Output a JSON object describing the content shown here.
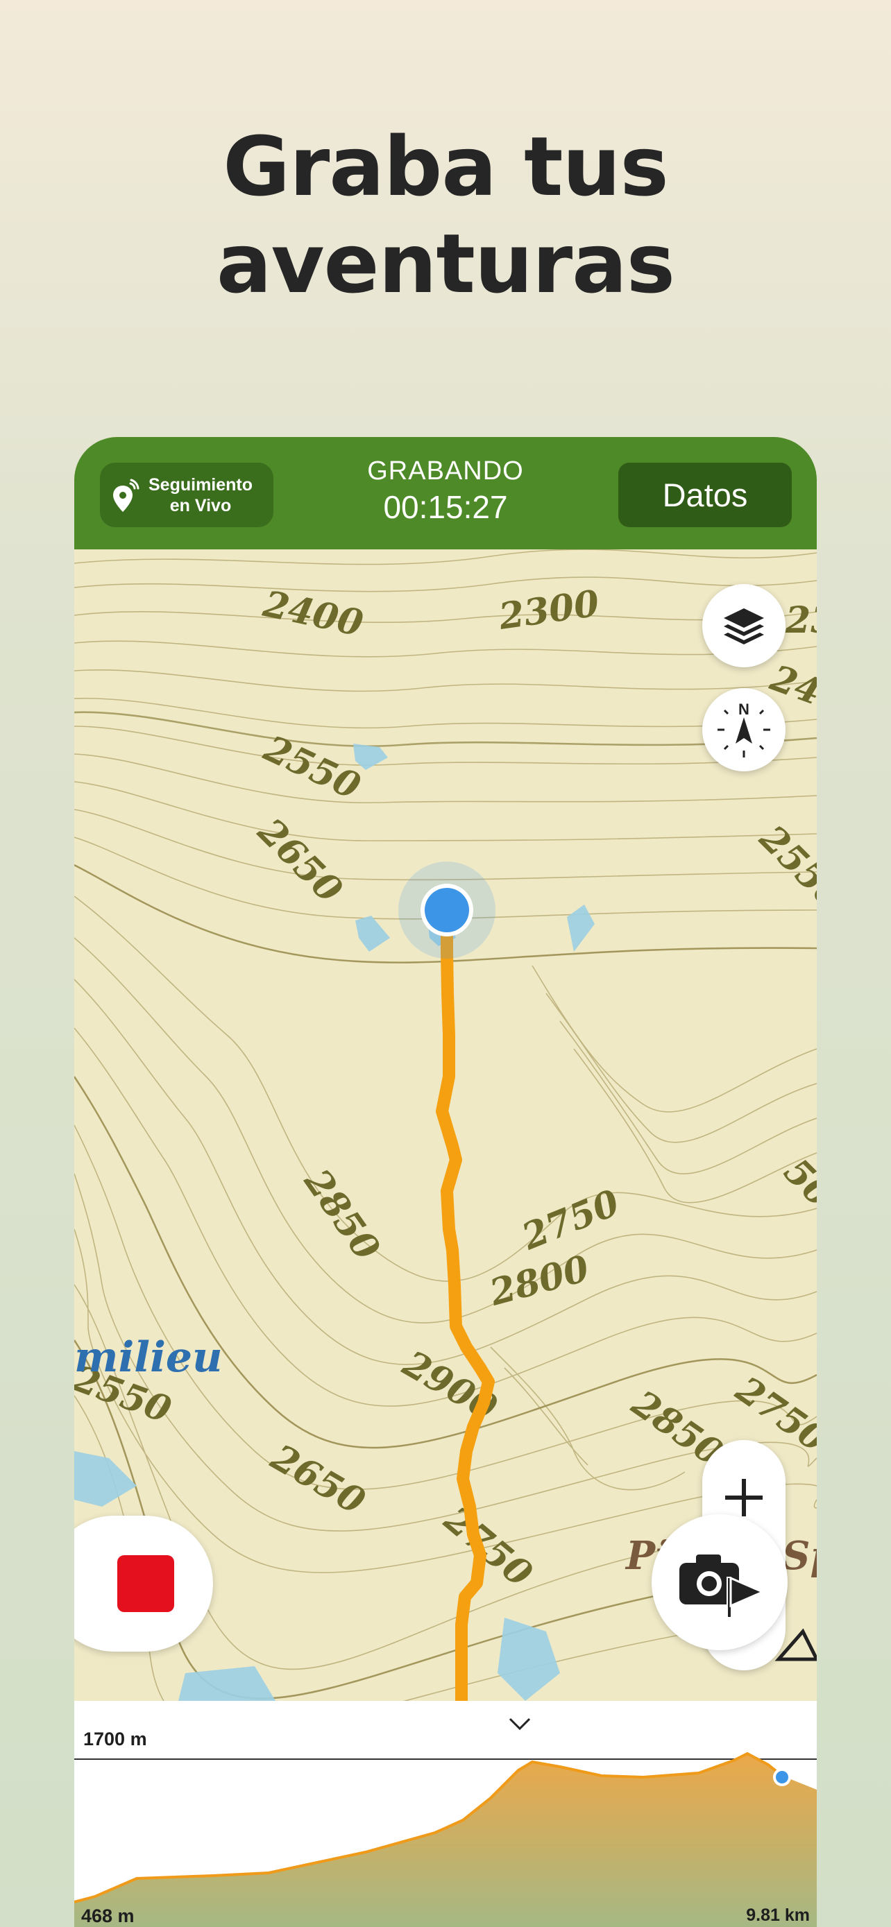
{
  "headline": {
    "line1": "Graba tus",
    "line2": "aventuras"
  },
  "topbar": {
    "live_tracking_line1": "Seguimiento",
    "live_tracking_line2": "en Vivo",
    "status": "GRABANDO",
    "elapsed_time": "00:15:27",
    "data_button": "Datos"
  },
  "map": {
    "contour_labels": [
      "2400",
      "2300",
      "23",
      "24",
      "2550",
      "2650",
      "2550",
      "2850",
      "2750",
      "2800",
      "50",
      "2900",
      "2850",
      "2750",
      "2550",
      "2650",
      "2750"
    ],
    "place_labels": [
      "milieu",
      "Pi",
      "Sp"
    ],
    "controls": {
      "layers_icon": "layers-icon",
      "compass_icon": "compass-icon",
      "compass_letter": "N",
      "zoom_in": "+",
      "zoom_out": "−"
    }
  },
  "colors": {
    "accent": "#4e8a28",
    "track": "#f5a010",
    "position": "#3d95e8",
    "stop": "#e5101e",
    "water": "#9ccfe3"
  },
  "elevation_profile": {
    "max_label": "1700 m",
    "min_label": "468 m",
    "distance_label": "9.81 km",
    "collapse_icon": "chevron-down-icon"
  }
}
